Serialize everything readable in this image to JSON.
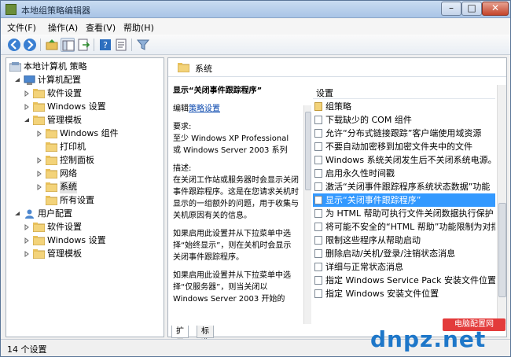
{
  "window": {
    "title": "本地组策略编辑器",
    "min": "–",
    "max": "□",
    "close": "✕"
  },
  "menu": [
    "文件(F)",
    "操作(A)",
    "查看(V)",
    "帮助(H)"
  ],
  "toolbar_icons": [
    "back-icon",
    "forward-icon",
    "up-folder-icon",
    "show-hide-tree-icon",
    "export-list-icon",
    "help-icon",
    "properties-icon",
    "filter-icon"
  ],
  "tree": {
    "root": "本地计算机 策略",
    "computer_config": "计算机配置",
    "software_settings": "软件设置",
    "windows_settings": "Windows 设置",
    "admin_templates": "管理模板",
    "windows_components": "Windows 组件",
    "printers": "打印机",
    "control_panel": "控制面板",
    "network": "网络",
    "system": "系统",
    "all_settings": "所有设置",
    "user_config": "用户配置",
    "user_software_settings": "软件设置",
    "user_windows_settings": "Windows 设置",
    "user_admin_templates": "管理模板"
  },
  "right_header": "系统",
  "description": {
    "title": "显示“关闭事件跟踪程序”",
    "edit_prefix": "编辑",
    "edit_link": "策略设置",
    "requirements_label": "要求:",
    "requirements": "至少 Windows XP Professional 或 Windows Server 2003 系列",
    "desc_label": "描述:",
    "desc1": "在关闭工作站或服务器时会显示关闭事件跟踪程序。这是在您请求关机时显示的一组额外的问题，用于收集与关机原因有关的信息。",
    "desc2": "如果启用此设置并从下拉菜单中选择“始终显示”，则在关机时会显示关闭事件跟踪程序。",
    "desc3": "如果启用此设置并从下拉菜单中选择“仅服务器”，则当关闭以 Windows Server 2003 开始的"
  },
  "list": {
    "header": "设置",
    "items": [
      "组策略",
      "下载缺少的 COM 组件",
      "允许“分布式链接跟踪”客户端使用域资源",
      "不要自动加密移到加密文件夹中的文件",
      "Windows 系统关闭发生后不关闭系统电源。",
      "启用永久性时间戳",
      "激活“关闭事件跟踪程序系统状态数据”功能",
      "显示“关闭事件跟踪程序”",
      "为 HTML 帮助可执行文件关闭数据执行保护",
      "将可能不安全的“HTML 帮助”功能限制为对指",
      "限制这些程序从帮助启动",
      "删除启动/关机/登录/注销状态消息",
      "详细与正常状态消息",
      "指定 Windows Service Pack 安装文件位置",
      "指定 Windows 安装文件位置"
    ],
    "selected_index": 7
  },
  "tabs": [
    "扩展",
    "标准"
  ],
  "status": "14 个设置",
  "watermark": {
    "badge": "电脑配置网",
    "brand": "dnpz.net"
  }
}
